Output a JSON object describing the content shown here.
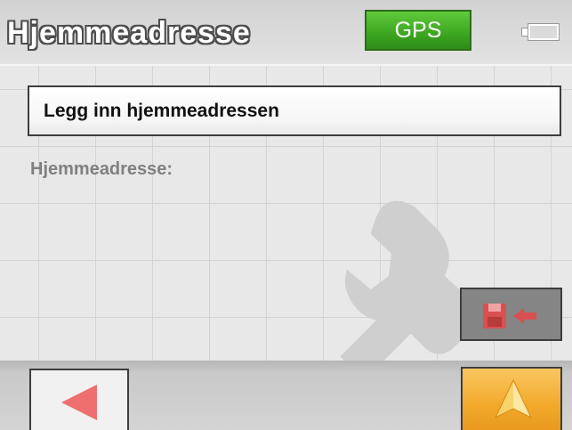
{
  "header": {
    "title": "Hjemmeadresse",
    "gps_label": "GPS",
    "gps_color": "#3fa923",
    "battery_icon": "battery-icon"
  },
  "main": {
    "input_button_label": "Legg inn hjemmeadressen",
    "address_label": "Hjemmeadresse:",
    "background_icon": "wrench-icon"
  },
  "actions": {
    "save_icon": "save-to-icon",
    "back_icon": "back-arrow-icon",
    "navigate_icon": "navigate-arrow-icon",
    "navigate_color": "#f2a92c",
    "back_color": "#ef6f6f"
  }
}
